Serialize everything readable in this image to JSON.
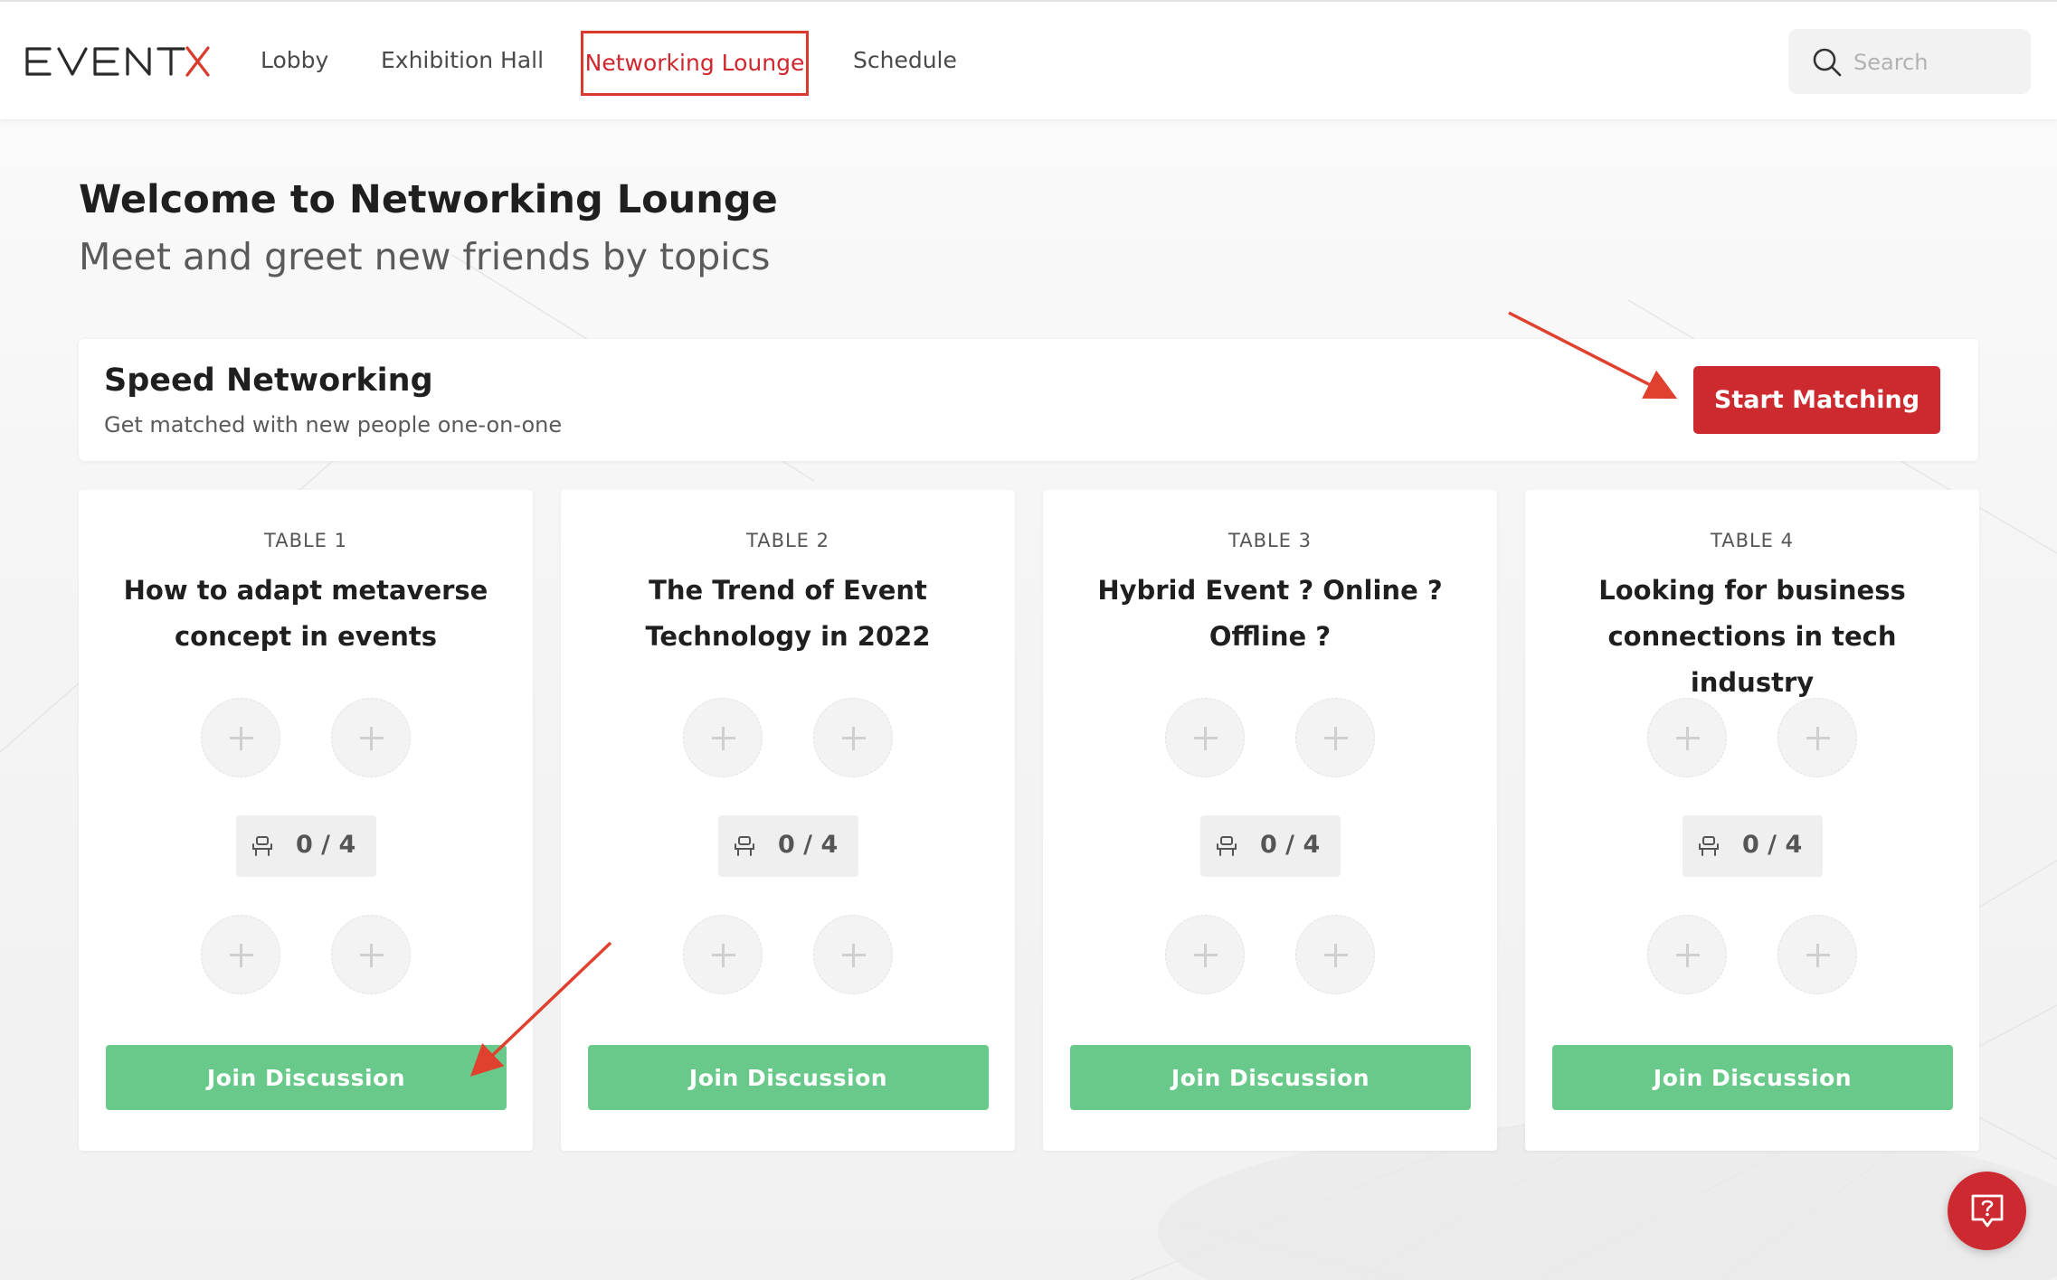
{
  "brand": {
    "logo_text": "EVENTX",
    "accent": "#cd2a2f",
    "success": "#69c98a"
  },
  "nav": {
    "items": [
      {
        "label": "Lobby",
        "active": false
      },
      {
        "label": "Exhibition Hall",
        "active": false
      },
      {
        "label": "Networking Lounge",
        "active": true
      },
      {
        "label": "Schedule",
        "active": false
      }
    ]
  },
  "search": {
    "placeholder": "Search",
    "value": ""
  },
  "welcome": {
    "title": "Welcome to Networking Lounge",
    "subtitle": "Meet and greet new friends by topics"
  },
  "speed_networking": {
    "title": "Speed Networking",
    "description": "Get matched with new people one-on-one",
    "button_label": "Start Matching"
  },
  "tables": [
    {
      "label": "TABLE 1",
      "topic": "How to adapt metaverse concept in events",
      "occupancy": "0 / 4",
      "join_label": "Join Discussion"
    },
    {
      "label": "TABLE 2",
      "topic": "The Trend of Event Technology in 2022",
      "occupancy": "0 / 4",
      "join_label": "Join Discussion"
    },
    {
      "label": "TABLE 3",
      "topic": "Hybrid Event ? Online ? Offline ?",
      "occupancy": "0 / 4",
      "join_label": "Join Discussion"
    },
    {
      "label": "TABLE 4",
      "topic": "Looking for business connections in tech industry",
      "occupancy": "0 / 4",
      "join_label": "Join Discussion"
    }
  ],
  "icons": {
    "search": "search-icon",
    "seat": "seat-icon",
    "add_seat": "plus-icon",
    "help": "help-chat-icon"
  }
}
